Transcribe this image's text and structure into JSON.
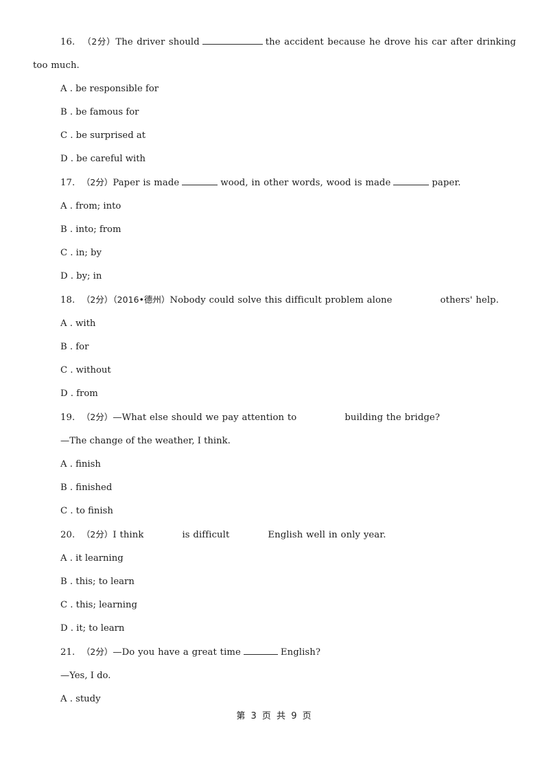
{
  "document": {
    "footer": "第 3 页 共 9 页",
    "page_number": 3,
    "total_pages": 9
  },
  "questions": [
    {
      "number": "16.",
      "score": "（2分）",
      "stem_before": "The driver should",
      "blank": "long-rule",
      "stem_after": "the accident because he drove his car after drinking too much.",
      "options": [
        {
          "letter": "A",
          "text": "be responsible for"
        },
        {
          "letter": "B",
          "text": "be famous for"
        },
        {
          "letter": "C",
          "text": "be surprised at"
        },
        {
          "letter": "D",
          "text": "be careful with"
        }
      ]
    },
    {
      "number": "17.",
      "score": "（2分）",
      "stem_part1": "Paper is made",
      "stem_part2": "wood, in other words, wood is made",
      "stem_part3": "paper.",
      "options": [
        {
          "letter": "A",
          "text": "from; into"
        },
        {
          "letter": "B",
          "text": "into; from"
        },
        {
          "letter": "C",
          "text": "in; by"
        },
        {
          "letter": "D",
          "text": "by; in"
        }
      ]
    },
    {
      "number": "18.",
      "score": "（2分）",
      "source": "（2016•德州）",
      "stem_before": "Nobody could solve this difficult problem alone",
      "stem_after": "others'  help.",
      "options": [
        {
          "letter": "A",
          "text": "with"
        },
        {
          "letter": "B",
          "text": "for"
        },
        {
          "letter": "C",
          "text": "without"
        },
        {
          "letter": "D",
          "text": "from"
        }
      ]
    },
    {
      "number": "19.",
      "score": "（2分）",
      "stem_before": "—What else should we pay attention to",
      "stem_after": "building the bridge?",
      "reply": "—The change of the weather, I think.",
      "options": [
        {
          "letter": "A",
          "text": "finish"
        },
        {
          "letter": "B",
          "text": "finished"
        },
        {
          "letter": "C",
          "text": "to finish"
        }
      ]
    },
    {
      "number": "20.",
      "score": "（2分）",
      "stem_part1": "I think",
      "stem_part2": "is difficult",
      "stem_part3": "English well in only year.",
      "options": [
        {
          "letter": "A",
          "text": "it learning"
        },
        {
          "letter": "B",
          "text": "this; to learn"
        },
        {
          "letter": "C",
          "text": "this; learning"
        },
        {
          "letter": "D",
          "text": "it; to learn"
        }
      ]
    },
    {
      "number": "21.",
      "score": "（2分）",
      "stem_before": "—Do you have a great time",
      "stem_after": "English?",
      "reply": "—Yes, I do.",
      "options": [
        {
          "letter": "A",
          "text": "study"
        }
      ]
    }
  ]
}
